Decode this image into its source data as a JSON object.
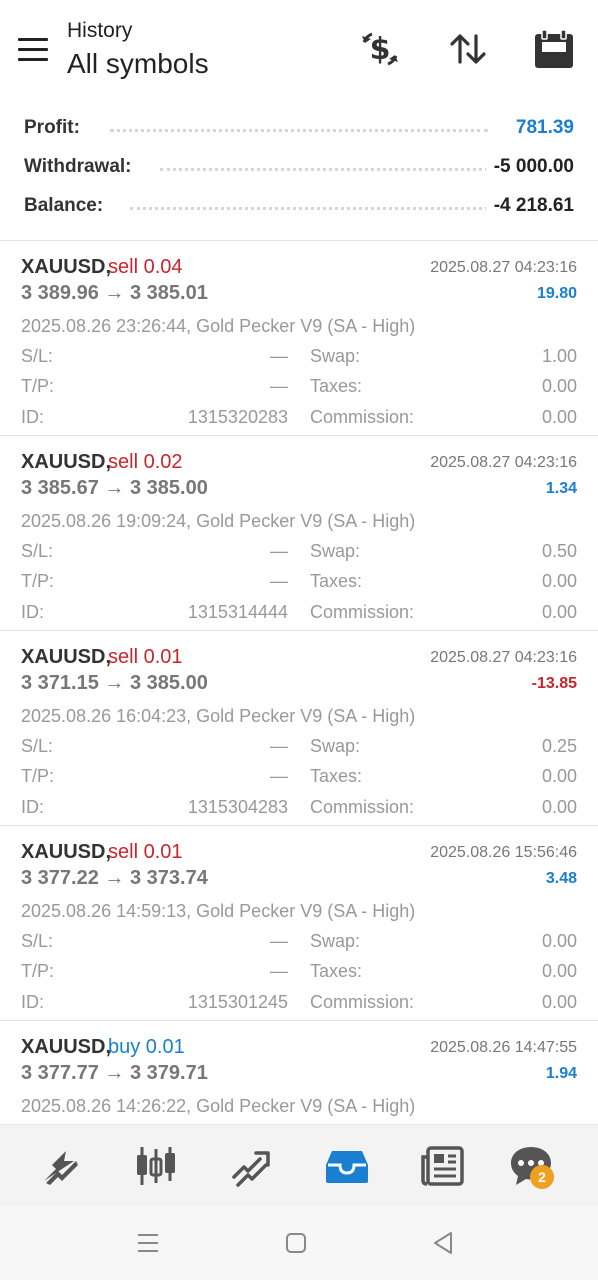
{
  "header": {
    "subtitle": "History",
    "title": "All symbols",
    "icons": [
      "menu-icon",
      "deposit-dollar-icon",
      "sort-icon",
      "calendar-icon"
    ]
  },
  "summary": {
    "profit_label": "Profit:",
    "profit_value": "781.39",
    "withdrawal_label": "Withdrawal:",
    "withdrawal_value": "-5 000.00",
    "balance_label": "Balance:",
    "balance_value": "-4 218.61"
  },
  "labels": {
    "sl": "S/L:",
    "tp": "T/P:",
    "id": "ID:",
    "swap": "Swap:",
    "taxes": "Taxes:",
    "commission": "Commission:"
  },
  "deals": [
    {
      "symbol": "XAUUSD,",
      "side": "sell 0.04",
      "close_time": "2025.08.27 04:23:16",
      "prices": "3 389.96 → 3 385.01",
      "profit": "19.80",
      "open_info": "2025.08.26 23:26:44, Gold Pecker V9 (SA - High)",
      "sl": "—",
      "tp": "—",
      "id": "1315320283",
      "swap": "1.00",
      "taxes": "0.00",
      "commission": "0.00"
    },
    {
      "symbol": "XAUUSD,",
      "side": "sell 0.02",
      "close_time": "2025.08.27 04:23:16",
      "prices": "3 385.67 → 3 385.00",
      "profit": "1.34",
      "open_info": "2025.08.26 19:09:24, Gold Pecker V9 (SA - High)",
      "sl": "—",
      "tp": "—",
      "id": "1315314444",
      "swap": "0.50",
      "taxes": "0.00",
      "commission": "0.00"
    },
    {
      "symbol": "XAUUSD,",
      "side": "sell 0.01",
      "close_time": "2025.08.27 04:23:16",
      "prices": "3 371.15 → 3 385.00",
      "profit": "-13.85",
      "open_info": "2025.08.26 16:04:23, Gold Pecker V9 (SA - High)",
      "sl": "—",
      "tp": "—",
      "id": "1315304283",
      "swap": "0.25",
      "taxes": "0.00",
      "commission": "0.00"
    },
    {
      "symbol": "XAUUSD,",
      "side": "sell 0.01",
      "close_time": "2025.08.26 15:56:46",
      "prices": "3 377.22 → 3 373.74",
      "profit": "3.48",
      "open_info": "2025.08.26 14:59:13, Gold Pecker V9 (SA - High)",
      "sl": "—",
      "tp": "—",
      "id": "1315301245",
      "swap": "0.00",
      "taxes": "0.00",
      "commission": "0.00"
    },
    {
      "symbol": "XAUUSD,",
      "side": "buy 0.01",
      "close_time": "2025.08.26 14:47:55",
      "prices": "3 377.77 → 3 379.71",
      "profit": "1.94",
      "open_info": "2025.08.26 14:26:22, Gold Pecker V9 (SA - High)"
    }
  ],
  "bottom_nav": {
    "items": [
      "quotes-icon",
      "chart-icon",
      "trade-icon",
      "history-icon",
      "news-icon",
      "chat-icon"
    ],
    "active": "history-icon",
    "chat_badge": "2"
  },
  "system_nav": [
    "recents-icon",
    "home-icon",
    "back-icon"
  ],
  "colors": {
    "profit_positive": "#1a7fd0",
    "profit_negative": "#c8262c",
    "sell": "#c8262c",
    "buy": "#1a7fd0",
    "active_nav": "#1a7fd0"
  }
}
